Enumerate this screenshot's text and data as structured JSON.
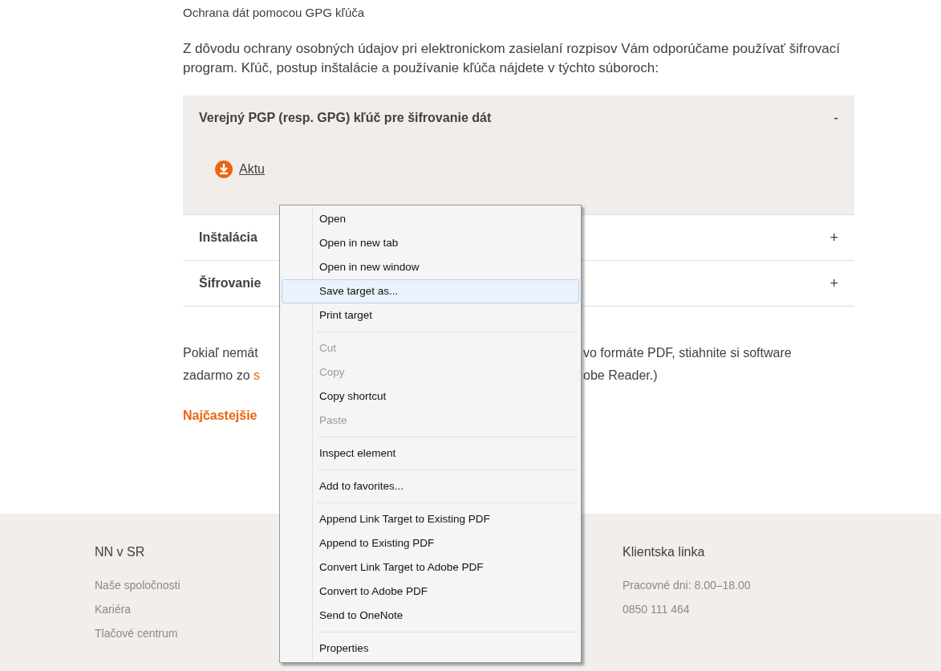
{
  "intro": {
    "title": "Ochrana dát pomocou GPG kľúča",
    "text": "Z dôvodu ochrany osobných údajov pri elektronickom zasielaní rozpisov Vám odporúčame používať šifrovací program. Kľúč, postup inštalácie a používanie kľúča nájdete v týchto súboroch:"
  },
  "accordion": [
    {
      "title": "Verejný PGP (resp. GPG) kľúč pre šifrovanie dát",
      "toggle": "-",
      "expanded": true,
      "link": "Aktu"
    },
    {
      "title": "Inštalácia",
      "toggle": "+",
      "expanded": false
    },
    {
      "title": "Šifrovanie",
      "toggle": "+",
      "expanded": false
    }
  ],
  "note": {
    "line_1_left": "Pokiaľ nemát",
    "line_1_right": "vo formáte PDF, stiahnite si software",
    "line_2_left": "zadarmo zo ",
    "line_2_link": "s",
    "line_2_right": "obe Reader.)"
  },
  "faq_link": "Najčastejšie",
  "footer": {
    "columns": [
      {
        "heading": "NN v SR",
        "lines": [
          "Naše spoločnosti",
          "Kariéra",
          "Tlačové centrum"
        ]
      },
      {
        "heading": "Klientska linka",
        "lines": [
          "Pracovné dni: 8.00–18.00",
          "0850 111 464"
        ]
      }
    ]
  },
  "context_menu": {
    "groups": [
      [
        {
          "label": "Open",
          "disabled": false,
          "selected": false
        },
        {
          "label": "Open in new tab",
          "disabled": false,
          "selected": false
        },
        {
          "label": "Open in new window",
          "disabled": false,
          "selected": false
        },
        {
          "label": "Save target as...",
          "disabled": false,
          "selected": true
        },
        {
          "label": "Print target",
          "disabled": false,
          "selected": false
        }
      ],
      [
        {
          "label": "Cut",
          "disabled": true,
          "selected": false
        },
        {
          "label": "Copy",
          "disabled": true,
          "selected": false
        },
        {
          "label": "Copy shortcut",
          "disabled": false,
          "selected": false
        },
        {
          "label": "Paste",
          "disabled": true,
          "selected": false
        }
      ],
      [
        {
          "label": "Inspect element",
          "disabled": false,
          "selected": false
        }
      ],
      [
        {
          "label": "Add to favorites...",
          "disabled": false,
          "selected": false
        }
      ],
      [
        {
          "label": "Append Link Target to Existing PDF",
          "disabled": false,
          "selected": false
        },
        {
          "label": "Append to Existing PDF",
          "disabled": false,
          "selected": false
        },
        {
          "label": "Convert Link Target to Adobe PDF",
          "disabled": false,
          "selected": false
        },
        {
          "label": "Convert to Adobe PDF",
          "disabled": false,
          "selected": false
        },
        {
          "label": "Send to OneNote",
          "disabled": false,
          "selected": false
        }
      ],
      [
        {
          "label": "Properties",
          "disabled": false,
          "selected": false
        }
      ]
    ]
  }
}
